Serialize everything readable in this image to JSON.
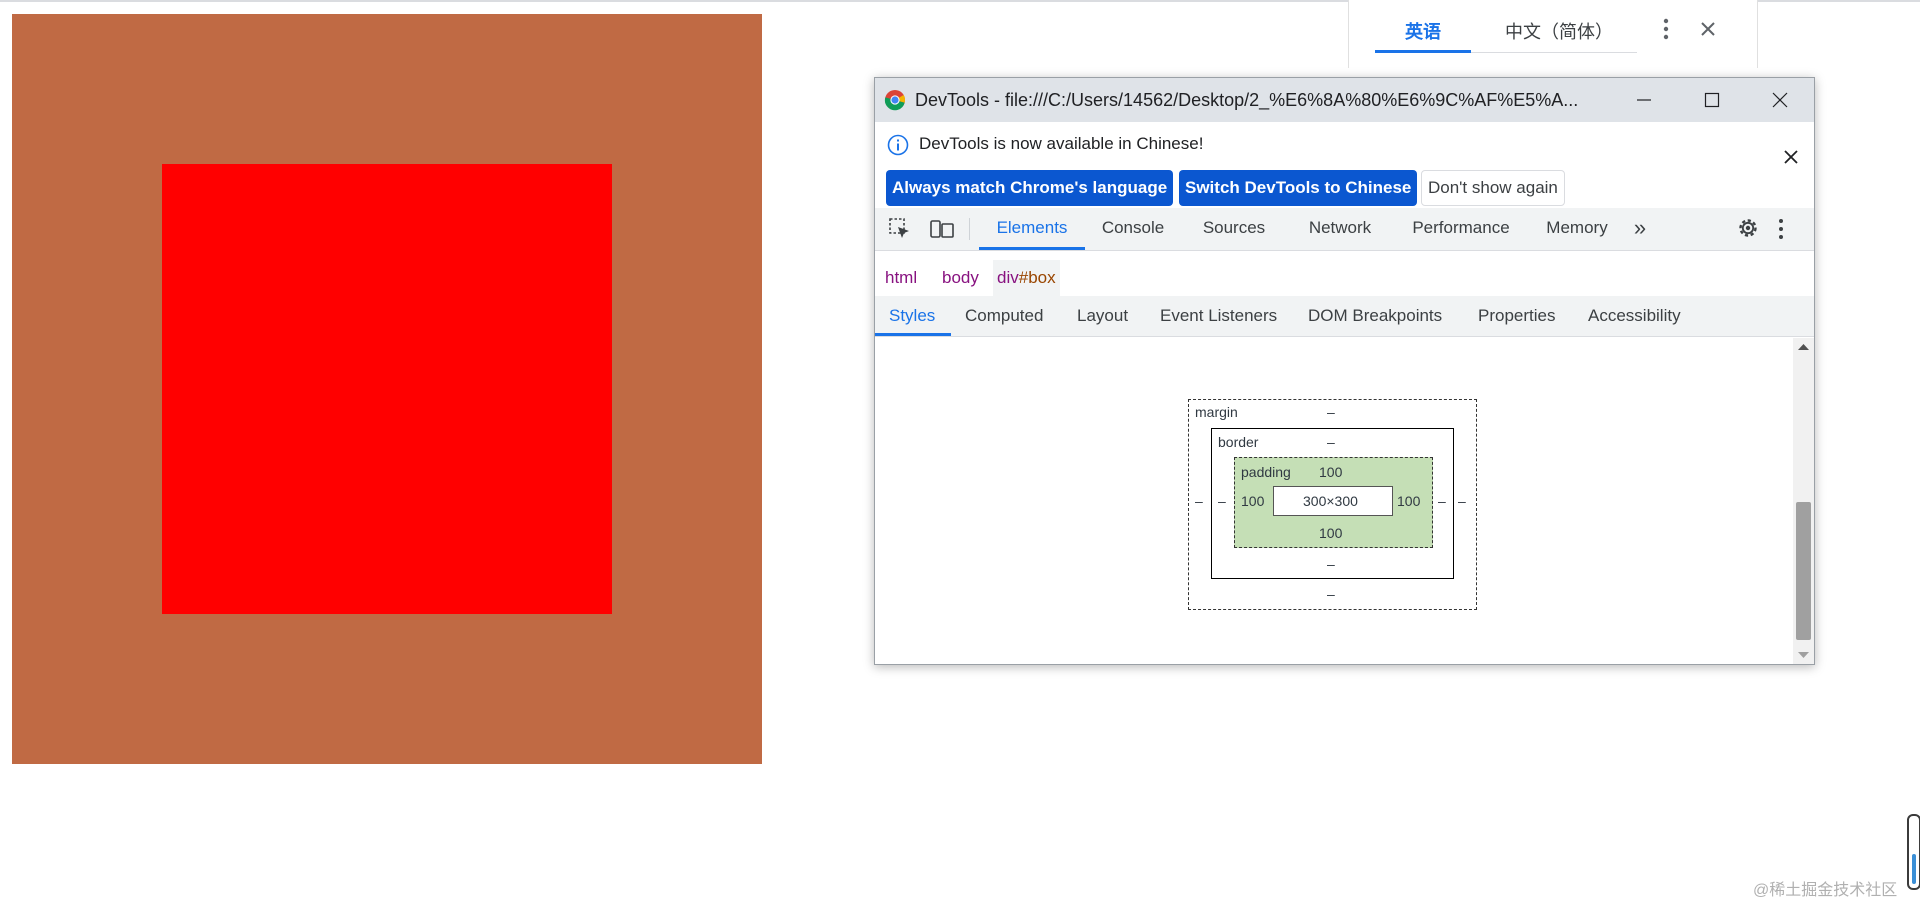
{
  "preview": {
    "outer_color": "#c06a44",
    "inner_color": "#ff0000"
  },
  "translate": {
    "tabs": [
      "英语",
      "中文（简体）"
    ],
    "active_tab": 0,
    "icons": [
      "more-vert-icon",
      "close-icon"
    ]
  },
  "devtools": {
    "title": "DevTools - file:///C:/Users/14562/Desktop/2_%E6%8A%80%E6%9C%AF%E5%A...",
    "infobar": {
      "message": "DevTools is now available in Chinese!",
      "btn_match": "Always match Chrome's language",
      "btn_switch": "Switch DevTools to Chinese",
      "btn_dismiss": "Don't show again"
    },
    "tabs": [
      "Elements",
      "Console",
      "Sources",
      "Network",
      "Performance",
      "Memory"
    ],
    "active_tab": "Elements",
    "more_tabs": "»",
    "breadcrumb": {
      "html": "html",
      "body": "body",
      "div_tag": "div",
      "div_id": "#box"
    },
    "subtabs": [
      "Styles",
      "Computed",
      "Layout",
      "Event Listeners",
      "DOM Breakpoints",
      "Properties",
      "Accessibility"
    ],
    "active_subtab": "Styles",
    "box_model": {
      "margin_label": "margin",
      "margin_top": "–",
      "margin_bottom": "–",
      "margin_left": "–",
      "margin_right": "–",
      "border_label": "border",
      "border_top": "–",
      "border_bottom": "–",
      "border_left": "–",
      "border_right": "–",
      "padding_label": "padding",
      "padding_top": "100",
      "padding_bottom": "100",
      "padding_left": "100",
      "padding_right": "100",
      "content": "300×300",
      "padding_color": "#c5dfb6"
    }
  },
  "watermark": "@稀土掘金技术社区"
}
